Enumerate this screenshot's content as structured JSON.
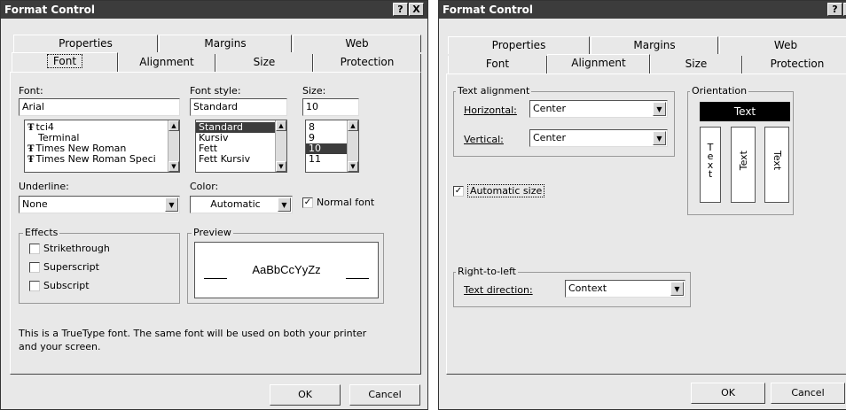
{
  "dialog1": {
    "title": "Format Control",
    "help_btn": "?",
    "close_btn": "X",
    "tabs_row1": [
      "Properties",
      "Margins",
      "Web"
    ],
    "tabs_row2": [
      "Font",
      "Alignment",
      "Size",
      "Protection"
    ],
    "selected_tab": "Font",
    "font_label": "Font:",
    "font_value": "Arial",
    "font_list": [
      {
        "name": "tci4",
        "icon": "truetype-icon",
        "tt": true
      },
      {
        "name": "Terminal",
        "tt": false
      },
      {
        "name": "Times New Roman",
        "icon": "truetype-icon",
        "tt": true
      },
      {
        "name": "Times New Roman Speci",
        "icon": "truetype-icon",
        "tt": true
      }
    ],
    "style_label": "Font style:",
    "style_value": "Standard",
    "style_list": [
      "Standard",
      "Kursiv",
      "Fett",
      "Fett Kursiv"
    ],
    "style_selected": "Standard",
    "size_label": "Size:",
    "size_value": "10",
    "size_list": [
      "8",
      "9",
      "10",
      "11"
    ],
    "size_selected": "10",
    "underline_label": "Underline:",
    "underline_value": "None",
    "color_label": "Color:",
    "color_value": "Automatic",
    "normal_font_label": "Normal font",
    "normal_font_checked": true,
    "effects_label": "Effects",
    "strikethrough_label": "Strikethrough",
    "superscript_label": "Superscript",
    "subscript_label": "Subscript",
    "preview_label": "Preview",
    "preview_text": "AaBbCcYyZz",
    "info_line1": "This is a TrueType font.  The same font will be used on both your printer",
    "info_line2": "and your screen.",
    "ok_label": "OK",
    "cancel_label": "Cancel"
  },
  "dialog2": {
    "title": "Format Control",
    "help_btn": "?",
    "close_btn": "X",
    "tabs_row1": [
      "Properties",
      "Margins",
      "Web"
    ],
    "tabs_row2": [
      "Font",
      "Alignment",
      "Size",
      "Protection"
    ],
    "selected_tab": "Alignment",
    "text_alignment_label": "Text alignment",
    "horizontal_label": "Horizontal:",
    "horizontal_value": "Center",
    "vertical_label": "Vertical:",
    "vertical_value": "Center",
    "orientation_label": "Orientation",
    "orientation_text": "Text",
    "orientation_stacked": [
      "T",
      "e",
      "x",
      "t"
    ],
    "automatic_size_label": "Automatic size",
    "automatic_size_checked": true,
    "rtl_label": "Right-to-left",
    "text_direction_label": "Text direction:",
    "text_direction_value": "Context",
    "ok_label": "OK",
    "cancel_label": "Cancel"
  },
  "colors": {
    "dialog_bg": "#e8e8e8",
    "titlebar_bg": "#3c3c3c",
    "selection_bg": "#3c3c3c"
  }
}
